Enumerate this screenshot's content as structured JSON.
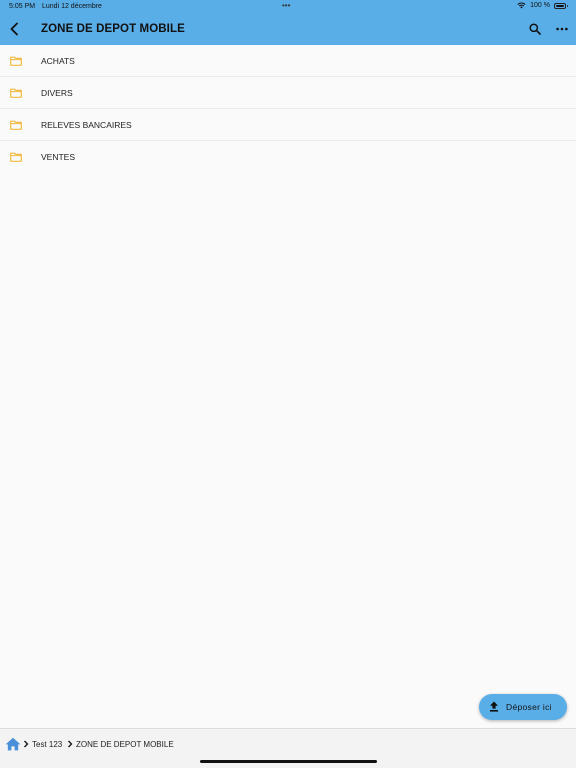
{
  "status_bar": {
    "time": "5:05 PM",
    "date": "Lundi 12 décembre",
    "dots": "•••",
    "battery_text": "100 %",
    "icons": [
      "wifi-icon",
      "battery-icon"
    ]
  },
  "header": {
    "title": "ZONE DE DEPOT MOBILE",
    "background_color": "#5aaee8",
    "icons": [
      "chevron-left-icon",
      "search-icon",
      "ellipsis-icon"
    ]
  },
  "folders": [
    {
      "label": "ACHATS",
      "icon": "folder-icon"
    },
    {
      "label": "DIVERS",
      "icon": "folder-icon"
    },
    {
      "label": "RELEVES BANCAIRES",
      "icon": "folder-icon"
    },
    {
      "label": "VENTES",
      "icon": "folder-icon"
    }
  ],
  "folder_icon_color": "#f1b940",
  "fab": {
    "label": "Déposer ici",
    "icon": "upload-icon"
  },
  "breadcrumb": {
    "home_icon": "home-icon",
    "home_icon_color": "#4a90d9",
    "items": [
      "Test 123",
      "ZONE DE DEPOT MOBILE"
    ]
  }
}
